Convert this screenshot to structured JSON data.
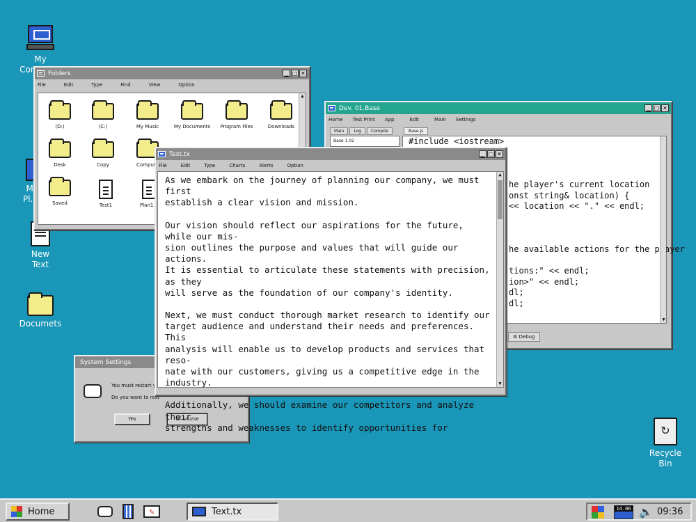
{
  "desktop": {
    "icons": [
      {
        "label": "My\nComputer"
      },
      {
        "label": "My\nPl..."
      },
      {
        "label": "New\nText"
      },
      {
        "label": "Documets"
      },
      {
        "label": "Recycle\nBin"
      }
    ]
  },
  "folders_window": {
    "title": "Folders",
    "menu": [
      "File",
      "Edit",
      "Type",
      "Find",
      "View",
      "Option"
    ],
    "items": [
      {
        "label": "(D:)",
        "kind": "folder"
      },
      {
        "label": "(C:)",
        "kind": "folder"
      },
      {
        "label": "My Music",
        "kind": "folder"
      },
      {
        "label": "My Documents",
        "kind": "folder"
      },
      {
        "label": "Program Files",
        "kind": "folder"
      },
      {
        "label": "Downloads",
        "kind": "folder"
      },
      {
        "label": "Desk",
        "kind": "folder"
      },
      {
        "label": "Copy",
        "kind": "folder"
      },
      {
        "label": "Compute",
        "kind": "folder"
      },
      {
        "label": "Saved",
        "kind": "folder"
      },
      {
        "label": "Test1",
        "kind": "file"
      },
      {
        "label": "Plan1.0",
        "kind": "file"
      }
    ]
  },
  "dev_window": {
    "title": "Dev. 01.Base",
    "menu": [
      "Home",
      "Test Print",
      "App",
      "Edit",
      "Main",
      "Settings"
    ],
    "tabs": [
      "Main",
      "Log",
      "Compile"
    ],
    "file_tab": "Base.js",
    "tree_item": "Base 1.02",
    "debug_tab": "Debug",
    "code_lines": [
      "#include <iostream>",
      "",
      "",
      "",
      "he player's current location",
      "onst string& location) {",
      "<< location << \".\" << endl;",
      "",
      "",
      "",
      "he available actions for the player",
      "",
      "tions:\" << endl;",
      "ion>\" << endl;",
      "dl;",
      "dl;"
    ]
  },
  "text_window": {
    "title": "Text.tx",
    "menu": [
      "File",
      "Edit",
      "Type",
      "Charts",
      "Alerts",
      "Option"
    ],
    "paragraphs": [
      "As we embark on the journey of planning our company, we must first\nestablish a clear vision and mission.",
      "Our vision should reflect our aspirations for the future, while our mis-\nsion outlines the purpose and values that will guide our actions.\nIt is essential to articulate these statements with precision, as they\nwill serve as the foundation of our company's identity.",
      "Next, we must conduct thorough market research to identify our\ntarget audience and understand their needs and preferences. This\nanalysis will enable us to develop products and services that reso-\nnate with our customers, giving us a competitive edge in the industry.",
      "Additionally, we should examine our competitors and analyze their\nstrengths and weaknesses to identify opportunities for"
    ]
  },
  "settings_dialog": {
    "title": "System Settings",
    "line1": "You must restart yo",
    "line2": "Do you want to rest",
    "yes_label": "Yes",
    "ofcourse_label": "Of course"
  },
  "taskbar": {
    "home_label": "Home",
    "task_label": "Text.tx",
    "calendar": "14.06",
    "clock": "09:36"
  }
}
